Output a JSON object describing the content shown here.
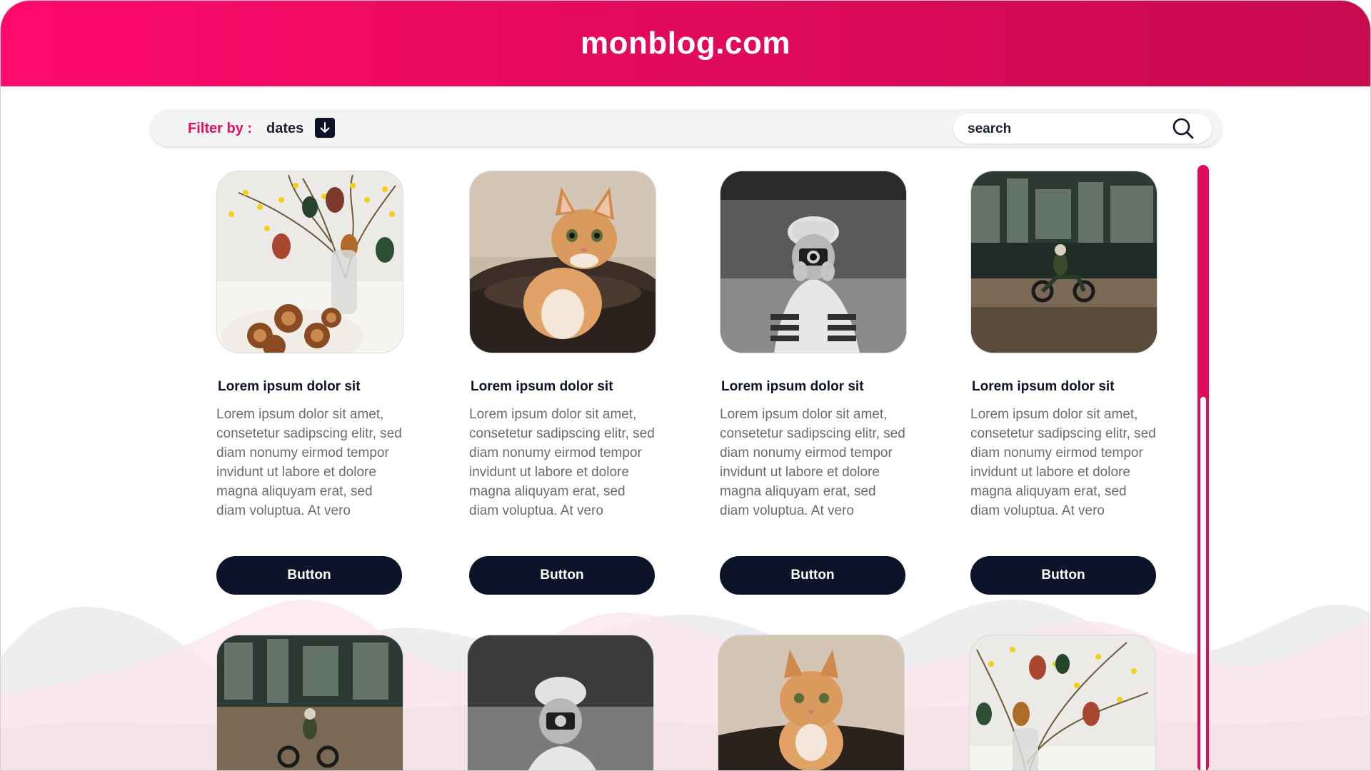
{
  "site": {
    "title": "monblog.com"
  },
  "filter": {
    "label": "Filter by :",
    "value": "dates"
  },
  "search": {
    "placeholder": "search"
  },
  "cards": [
    {
      "title": "Lorem ipsum dolor sit",
      "text": "Lorem ipsum dolor sit amet, consetetur sadipscing elitr, sed diam nonumy eirmod tempor invidunt ut labore et dolore magna aliquyam erat, sed diam voluptua. At vero",
      "button": "Button",
      "image": "easter-eggs-branches"
    },
    {
      "title": "Lorem ipsum dolor sit",
      "text": "Lorem ipsum dolor sit amet, consetetur sadipscing elitr, sed diam nonumy eirmod tempor invidunt ut labore et dolore magna aliquyam erat, sed diam voluptua. At vero",
      "button": "Button",
      "image": "cat-in-basket"
    },
    {
      "title": "Lorem ipsum dolor sit",
      "text": "Lorem ipsum dolor sit amet, consetetur sadipscing elitr, sed diam nonumy eirmod tempor invidunt ut labore et dolore magna aliquyam erat, sed diam voluptua. At vero",
      "button": "Button",
      "image": "photographer-bw"
    },
    {
      "title": "Lorem ipsum dolor sit",
      "text": "Lorem ipsum dolor sit amet, consetetur sadipscing elitr, sed diam nonumy eirmod tempor invidunt ut labore et dolore magna aliquyam erat, sed diam voluptua. At vero",
      "button": "Button",
      "image": "motorcycle-rider"
    }
  ],
  "row2_images": [
    "motorcycle-rider",
    "photographer-bw",
    "cat-in-basket",
    "easter-eggs-branches"
  ],
  "colors": {
    "accent": "#e0105f",
    "header_start": "#ff0a6c",
    "header_end": "#c80a4e",
    "button": "#0c1429",
    "text": "#6b6b6b"
  }
}
